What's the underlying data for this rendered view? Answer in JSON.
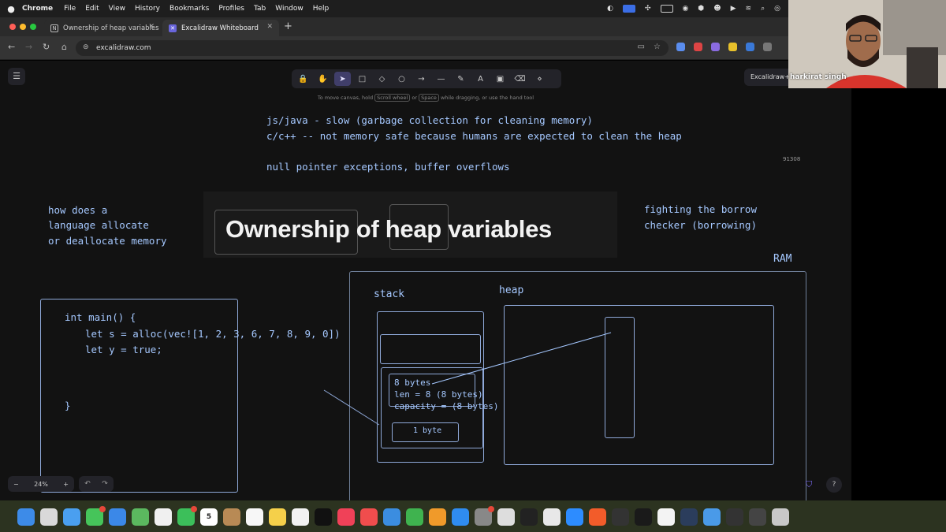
{
  "menubar": {
    "app_name": "Chrome",
    "items": [
      "File",
      "Edit",
      "View",
      "History",
      "Bookmarks",
      "Profiles",
      "Tab",
      "Window",
      "Help"
    ]
  },
  "tabs": [
    {
      "label": "Ownership of heap variables",
      "active": false
    },
    {
      "label": "Excalidraw Whiteboard",
      "active": true
    }
  ],
  "address": {
    "url": "excalidraw.com"
  },
  "excalidraw": {
    "hint": {
      "pre": "To move canvas, hold",
      "key1": "Scroll wheel",
      "mid": "or",
      "key2": "Space",
      "post": "while dragging, or use the hand tool"
    },
    "plus_label": "Excalidraw+",
    "counter": "91308",
    "zoom": "24%",
    "tools": [
      {
        "icon": "lock-icon",
        "glyph": "🔒"
      },
      {
        "icon": "hand-icon",
        "glyph": "✋"
      },
      {
        "icon": "selection-icon",
        "glyph": "➤",
        "active": true
      },
      {
        "icon": "rectangle-icon",
        "glyph": "□"
      },
      {
        "icon": "diamond-icon",
        "glyph": "◇"
      },
      {
        "icon": "ellipse-icon",
        "glyph": "○"
      },
      {
        "icon": "arrow-icon",
        "glyph": "→"
      },
      {
        "icon": "line-icon",
        "glyph": "—"
      },
      {
        "icon": "pencil-icon",
        "glyph": "✎"
      },
      {
        "icon": "text-icon",
        "glyph": "A"
      },
      {
        "icon": "image-icon",
        "glyph": "▣"
      },
      {
        "icon": "eraser-icon",
        "glyph": "⌫"
      },
      {
        "icon": "shapes-icon",
        "glyph": "⋄"
      }
    ]
  },
  "board": {
    "line1": "js/java - slow (garbage collection for cleaning memory)",
    "line2": "c/c++ -- not memory safe because humans are expected to clean the heap",
    "line3": "null pointer exceptions, buffer overflows",
    "left_note": [
      "how does a",
      "language allocate",
      "or deallocate memory"
    ],
    "right_note": [
      "fighting the borrow",
      "checker (borrowing)"
    ],
    "title": "Ownership of heap variables",
    "ram_label": "RAM",
    "stack_label": "stack",
    "heap_label": "heap",
    "code": [
      "int main() {",
      "let s = alloc(vec![1, 2, 3, 6, 7, 8, 9, 0])",
      "let y = true;",
      "}"
    ],
    "frame_text": [
      "8 bytes",
      "len = 8 (8 bytes)",
      "capacity = (8 bytes)"
    ],
    "one_byte": "1 byte"
  },
  "webcam": {
    "name": "harkirat singh"
  },
  "dock": {
    "calendar_day": "5",
    "calendar_month": "APR"
  }
}
